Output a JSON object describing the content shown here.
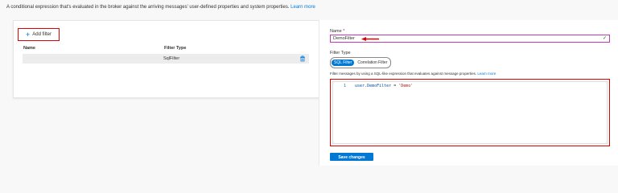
{
  "description": {
    "text": "A conditional expression that's evaluated in the broker against the arriving messages' user-defined properties and system properties.",
    "link": "Learn more"
  },
  "filters_table": {
    "add_label": "Add filter",
    "columns": [
      "Name",
      "Filter Type"
    ],
    "rows": [
      {
        "name": "",
        "type": "SqlFilter"
      }
    ]
  },
  "form": {
    "name_label": "Name",
    "required_marker": "*",
    "name_value": "DemoFilter",
    "filter_type_label": "Filter Type",
    "filter_types": [
      "SQL Filter",
      "Correlation Filter"
    ],
    "selected_filter_type": "SQL Filter",
    "hint_text": "Filter messages by using a SQL-like expression that evaluates against message properties.",
    "hint_link": "Learn more",
    "code": {
      "line_number": "1",
      "ident": "user.DemoFilter",
      "op": "=",
      "string": "'Demo'"
    },
    "save_label": "Save changes"
  },
  "colors": {
    "accent": "#0078d4",
    "highlight": "#e00000",
    "focus_border": "#c239b3",
    "valid": "#107c10"
  },
  "icons": [
    "plus-icon",
    "trash-icon",
    "check-icon",
    "arrow-annotation"
  ]
}
